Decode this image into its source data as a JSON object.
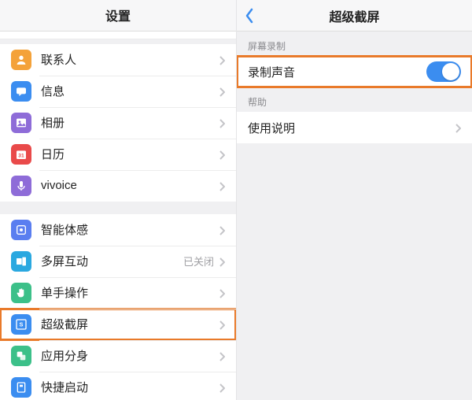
{
  "left": {
    "title": "设置",
    "group1": [
      {
        "key": "contacts",
        "label": "联系人",
        "icon": "person",
        "color": "#f4a23a"
      },
      {
        "key": "messages",
        "label": "信息",
        "icon": "message",
        "color": "#3b8df0"
      },
      {
        "key": "photos",
        "label": "相册",
        "icon": "photo",
        "color": "#8e6cd8"
      },
      {
        "key": "calendar",
        "label": "日历",
        "icon": "calendar",
        "color": "#e94a4a"
      },
      {
        "key": "vivoice",
        "label": "vivoice",
        "icon": "mic",
        "color": "#8e6cd8"
      }
    ],
    "group2": [
      {
        "key": "smart",
        "label": "智能体感",
        "icon": "smart",
        "color": "#5a7ef0"
      },
      {
        "key": "multi",
        "label": "多屏互动",
        "icon": "multi",
        "color": "#2aa8e0",
        "value": "已关闭"
      },
      {
        "key": "onehand",
        "label": "单手操作",
        "icon": "onehand",
        "color": "#3cc089"
      },
      {
        "key": "screenshot",
        "label": "超级截屏",
        "icon": "screenshot",
        "color": "#3b8df0",
        "highlight": true
      },
      {
        "key": "appclone",
        "label": "应用分身",
        "icon": "appclone",
        "color": "#3cc089"
      },
      {
        "key": "quick",
        "label": "快捷启动",
        "icon": "quick",
        "color": "#3b8df0"
      }
    ]
  },
  "right": {
    "title": "超级截屏",
    "sec_record": "屏幕录制",
    "row_record_audio": "录制声音",
    "sec_help": "帮助",
    "row_instructions": "使用说明"
  }
}
